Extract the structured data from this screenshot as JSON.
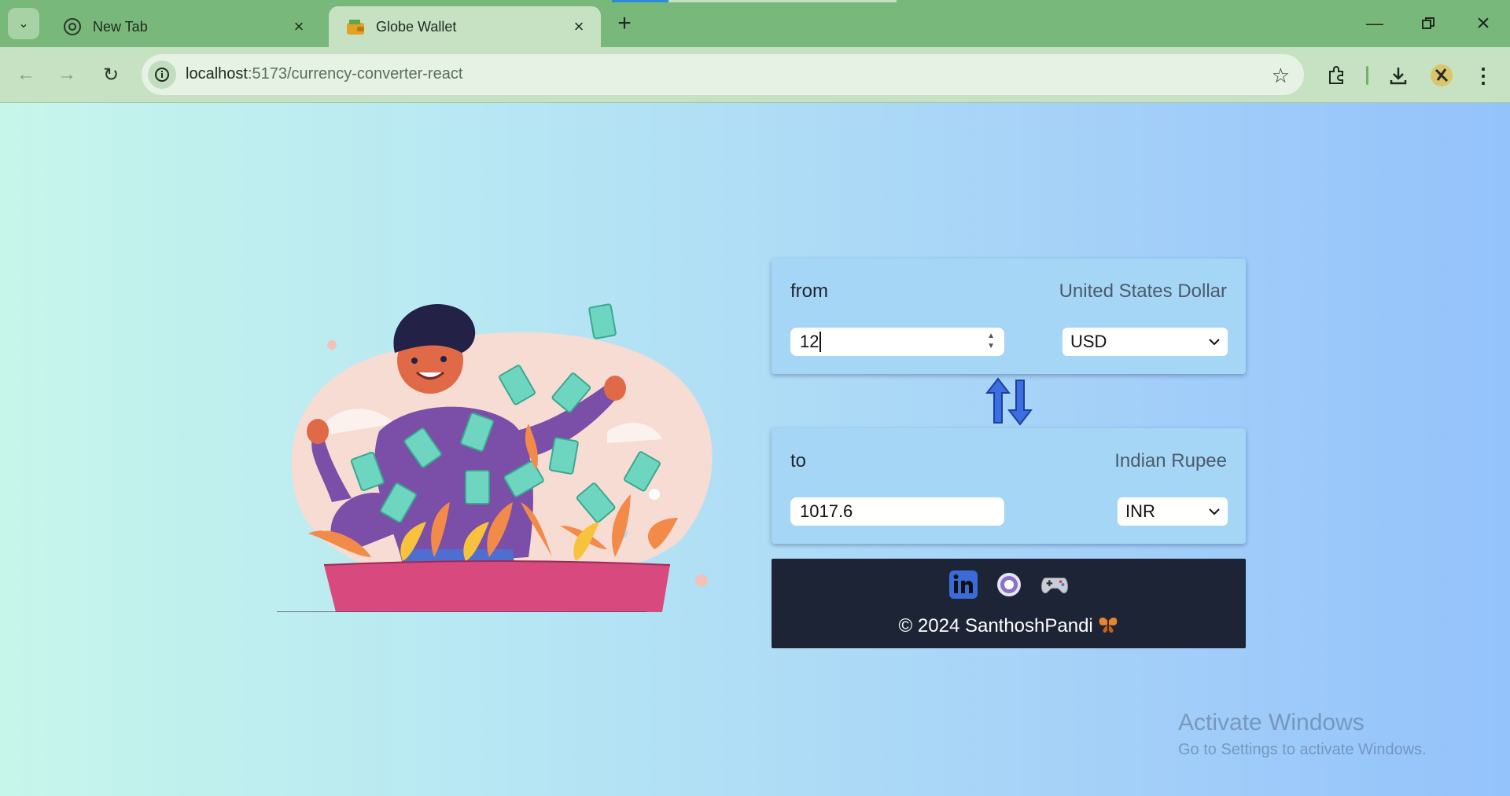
{
  "browser": {
    "tabs": [
      {
        "title": "New Tab",
        "icon": "chrome-icon",
        "active": false
      },
      {
        "title": "Globe Wallet",
        "icon": "wallet-icon",
        "active": true
      }
    ],
    "address": {
      "host": "localhost",
      "path": ":5173/currency-converter-react"
    },
    "colors": {
      "frame": "#78b87a",
      "toolbar": "#c6e2c3",
      "omnibox": "#e6f2e4"
    }
  },
  "converter": {
    "from": {
      "label": "from",
      "currency_name": "United States Dollar",
      "amount": "12",
      "currency_code": "USD"
    },
    "to": {
      "label": "to",
      "currency_name": "Indian Rupee",
      "amount": "1017.6",
      "currency_code": "INR"
    }
  },
  "footer": {
    "copyright": "© 2024 SanthoshPandi",
    "links": [
      "linkedin-icon",
      "github-icon",
      "gamepad-icon"
    ]
  },
  "watermark": {
    "line1": "Activate Windows",
    "line2": "Go to Settings to activate Windows."
  }
}
